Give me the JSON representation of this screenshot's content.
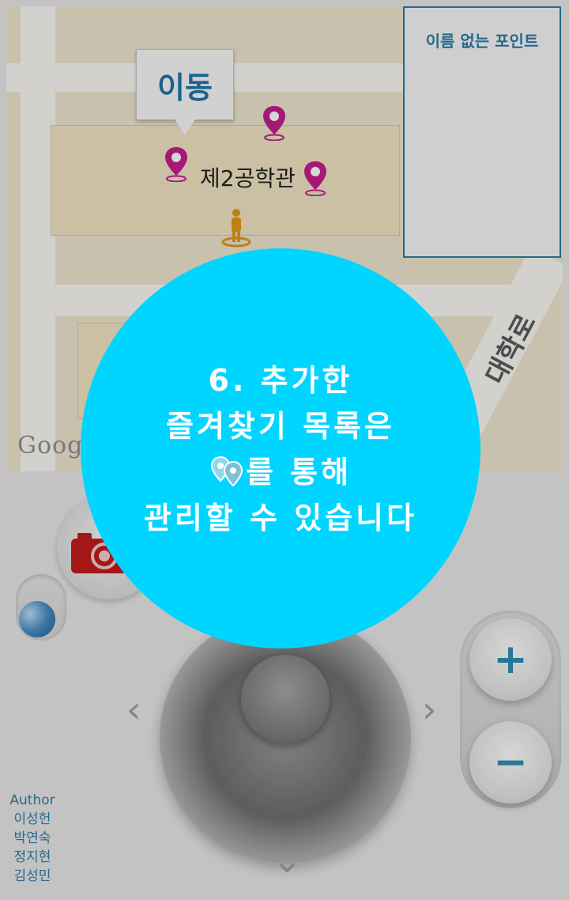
{
  "map": {
    "callout_label": "이동",
    "building_label": "제2공학관",
    "google_logo": "Goog",
    "road_label": "대학로"
  },
  "info_panel": {
    "title": "이름 없는 포인트"
  },
  "controls": {
    "zoom_in_label": "+",
    "zoom_out_label": "−",
    "left_arrow": "‹",
    "right_arrow": "›",
    "down_arrow": "⌄"
  },
  "authors": {
    "heading": "Author",
    "names": [
      "이성헌",
      "박연숙",
      "정지현",
      "김성민"
    ]
  },
  "tip": {
    "line1": "6. 추가한",
    "line2": "즐겨찾기 목록은",
    "line3_suffix": "를 통해",
    "line4": "관리할 수 있습니다"
  },
  "colors": {
    "pin": "#c41e8f",
    "tip_background": "#00d5ff",
    "accent": "#2e7ea8",
    "camera": "#c51b1b"
  },
  "icons": [
    "location-pin-icon",
    "person-icon",
    "camera-icon",
    "favorites-pins-icon"
  ]
}
